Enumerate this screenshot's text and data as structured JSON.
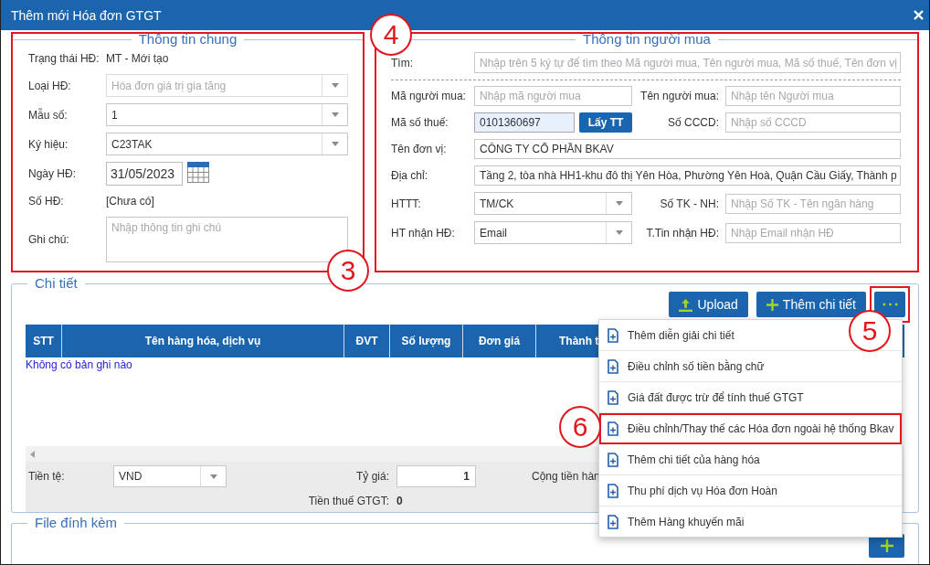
{
  "window": {
    "title": "Thêm mới Hóa đơn GTGT"
  },
  "general_info": {
    "legend": "Thông tin chung",
    "outlined": true,
    "callout": "3",
    "fields": [
      {
        "kind": "text",
        "label": "Trạng thái HĐ:",
        "value": "MT - Mới tạo",
        "disabled": false
      },
      {
        "kind": "select",
        "label": "Loại HĐ:",
        "value": "Hóa đơn giá trị gia tăng",
        "disabled": true
      },
      {
        "kind": "select",
        "label": "Mẫu số:",
        "value": "1",
        "disabled": false
      },
      {
        "kind": "select",
        "label": "Ký hiệu:",
        "value": "C23TAK",
        "disabled": false
      },
      {
        "kind": "date",
        "label": "Ngày HĐ:",
        "value": "31/05/2023",
        "disabled": false
      },
      {
        "kind": "text",
        "label": "Số HĐ:",
        "value": "[Chưa có]",
        "disabled": false
      },
      {
        "kind": "textarea",
        "label": "Ghi chú:",
        "placeholder": "Nhập thông tin ghi chú",
        "disabled": false
      }
    ]
  },
  "buyer_info": {
    "legend": "Thông tin người mua",
    "outlined": true,
    "callout": "4",
    "search": {
      "label": "Tìm:",
      "placeholder": "Nhập trên 5 ký tự để tìm theo Mã người mua, Tên người mua, Mã số thuế, Tên đơn vị"
    },
    "rows": [
      {
        "fields": [
          {
            "kind": "input",
            "label": "Mã người mua:",
            "placeholder": "Nhập mã người mua",
            "autofilled": false
          },
          {
            "kind": "input",
            "label": "Tên người mua:",
            "placeholder": "Nhập tên Người mua",
            "autofilled": false
          }
        ]
      },
      {
        "fields": [
          {
            "kind": "lookup",
            "label": "Mã số thuế:",
            "value": "0101360697",
            "button": "Lấy TT",
            "autofilled": true
          },
          {
            "kind": "input",
            "label": "Số CCCD:",
            "placeholder": "Nhập số CCCD",
            "autofilled": false
          }
        ]
      },
      {
        "fields": [
          {
            "kind": "input",
            "label": "Tên đơn vị:",
            "value": "CÔNG TY CỔ PHẦN BKAV",
            "autofilled": false
          }
        ]
      },
      {
        "fields": [
          {
            "kind": "input",
            "label": "Địa chỉ:",
            "value": "Tầng 2, tòa nhà HH1-khu đô thị Yên Hòa, Phường Yên Hoà, Quận Cầu Giấy, Thành p",
            "autofilled": false
          }
        ]
      },
      {
        "fields": [
          {
            "kind": "select",
            "label": "HTTT:",
            "value": "TM/CK",
            "autofilled": false
          },
          {
            "kind": "input",
            "label": "Số TK - NH:",
            "placeholder": "Nhập Số TK - Tên ngân hàng",
            "autofilled": false
          }
        ]
      },
      {
        "fields": [
          {
            "kind": "select",
            "label": "HT nhận HĐ:",
            "value": "Email",
            "autofilled": false
          },
          {
            "kind": "input",
            "label": "T.Tin nhận HĐ:",
            "placeholder": "Nhập Email nhận HĐ",
            "autofilled": false
          }
        ]
      }
    ]
  },
  "details": {
    "legend": "Chi tiết",
    "buttons": [
      {
        "kind": "upload",
        "label": "Upload",
        "outlined": false
      },
      {
        "kind": "add",
        "label": "Thêm chi tiết",
        "outlined": false
      },
      {
        "kind": "more",
        "outlined": true,
        "callout": "5"
      }
    ],
    "table": {
      "columns": [
        "STT",
        "Tên hàng hóa, dịch vụ",
        "ĐVT",
        "Số lượng",
        "Đơn giá",
        "Thành t"
      ],
      "empty_message": "Không có bản ghi nào"
    },
    "totals": {
      "currency": {
        "label": "Tiền tệ:",
        "value": "VND"
      },
      "rate": {
        "label": "Tỷ giá:",
        "value": "1"
      },
      "subtotal_label": "Cộng tiền hàn",
      "vat": {
        "label": "Tiền thuế GTGT:",
        "value": "0"
      }
    }
  },
  "attachments": {
    "legend": "File đính kèm"
  },
  "more_menu": {
    "items": [
      {
        "label": "Thêm diễn giải chi tiết",
        "outlined": false
      },
      {
        "label": "Điều chỉnh số tiền bằng chữ",
        "outlined": false
      },
      {
        "label": "Giá đất được trừ để tính thuế GTGT",
        "outlined": false
      },
      {
        "label": "Điều chỉnh/Thay thế các Hóa đơn ngoài hệ thống Bkav",
        "outlined": true,
        "callout": "6"
      },
      {
        "label": "Thêm chi tiết của hàng hóa",
        "outlined": false
      },
      {
        "label": "Thu phí dịch vụ Hóa đơn Hoàn",
        "outlined": false
      },
      {
        "label": "Thêm Hàng khuyến mãi",
        "outlined": false
      }
    ]
  }
}
